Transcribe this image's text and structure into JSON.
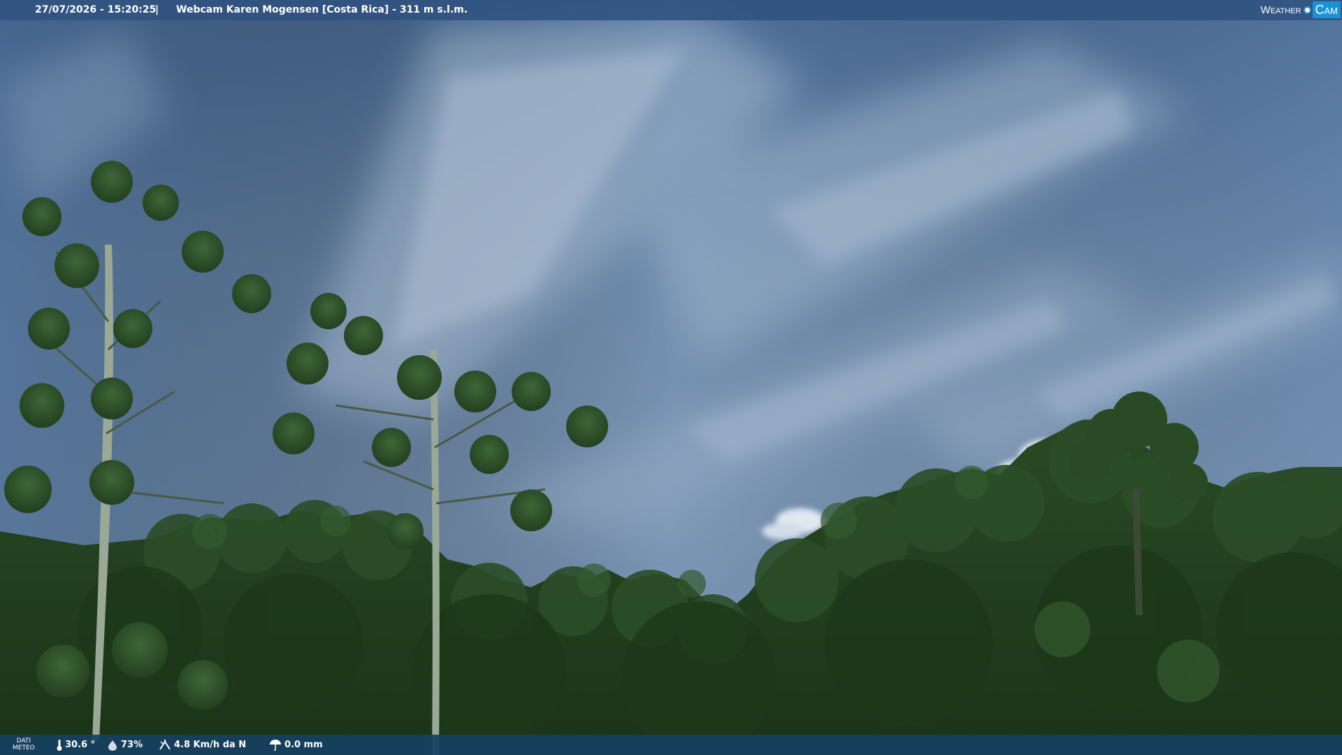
{
  "header": {
    "timestamp": "27/07/2026 - 15:20:25",
    "separator": "|",
    "title": "Webcam Karen Mogensen [Costa Rica]  - 311 m s.l.m."
  },
  "logo": {
    "word1": "Weather",
    "word2": "Cam",
    "accent_color": "#1a92d8"
  },
  "weather": {
    "section_label_line1": "DATI",
    "section_label_line2": "METEO",
    "temperature": "30.6 °",
    "humidity": "73%",
    "wind": "4.8 Km/h da N",
    "rain": "0.0 mm",
    "icons": [
      "thermometer-icon",
      "humidity-drop-icon",
      "wind-icon",
      "rain-icon"
    ]
  },
  "colors": {
    "top_bar": "#305280",
    "bottom_bar": "#164062",
    "sky_top": "#4a6d96",
    "sky_light": "#9fb4cc",
    "foliage": "#1f3f1c"
  }
}
